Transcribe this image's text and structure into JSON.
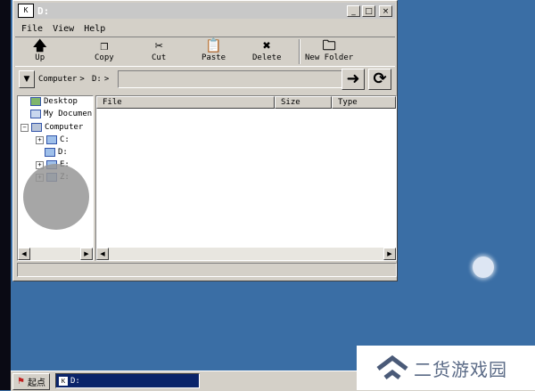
{
  "window": {
    "title": "D:",
    "app_icon_text": "K",
    "controls": {
      "minimize": "_",
      "maximize": "□",
      "close": "×"
    }
  },
  "menu": [
    "File",
    "View",
    "Help"
  ],
  "toolbar": [
    {
      "label": "Up",
      "icon": "up-arrow-icon",
      "glyph": "🡅"
    },
    {
      "label": "Copy",
      "icon": "copy-icon",
      "glyph": "❐"
    },
    {
      "label": "Cut",
      "icon": "scissors-icon",
      "glyph": "✂"
    },
    {
      "label": "Paste",
      "icon": "paste-icon",
      "glyph": "📋"
    },
    {
      "label": "Delete",
      "icon": "delete-icon",
      "glyph": "✖"
    },
    {
      "label": "New Folder",
      "icon": "new-folder-icon",
      "glyph": "🗀"
    }
  ],
  "address": {
    "crumbs": [
      "Computer",
      "D:"
    ],
    "value": "",
    "go_glyph": "➜",
    "refresh_glyph": "⟳"
  },
  "tree": [
    {
      "label": "Desktop",
      "icon": "desktop-icon",
      "expander": ""
    },
    {
      "label": "My Documen",
      "icon": "my-documents-icon",
      "expander": ""
    },
    {
      "label": "Computer",
      "icon": "computer-icon",
      "expander": "−"
    },
    {
      "label": "C:",
      "icon": "drive-icon",
      "expander": "+"
    },
    {
      "label": "D:",
      "icon": "drive-icon",
      "expander": ""
    },
    {
      "label": "E:",
      "icon": "drive-icon",
      "expander": "+"
    },
    {
      "label": "Z:",
      "icon": "drive-icon",
      "expander": "+"
    }
  ],
  "file_list": {
    "columns": [
      "File",
      "Size",
      "Type"
    ],
    "rows": []
  },
  "scroll_arrows": {
    "left": "◀",
    "right": "▶"
  },
  "taskbar": {
    "start_label": "起点",
    "task_label": "D:"
  },
  "watermark": {
    "text": "二货游戏园"
  },
  "colors": {
    "desktop": "#3a6ea5",
    "window_face": "#d4d0c8",
    "taskbar_active": "#0a246a"
  }
}
